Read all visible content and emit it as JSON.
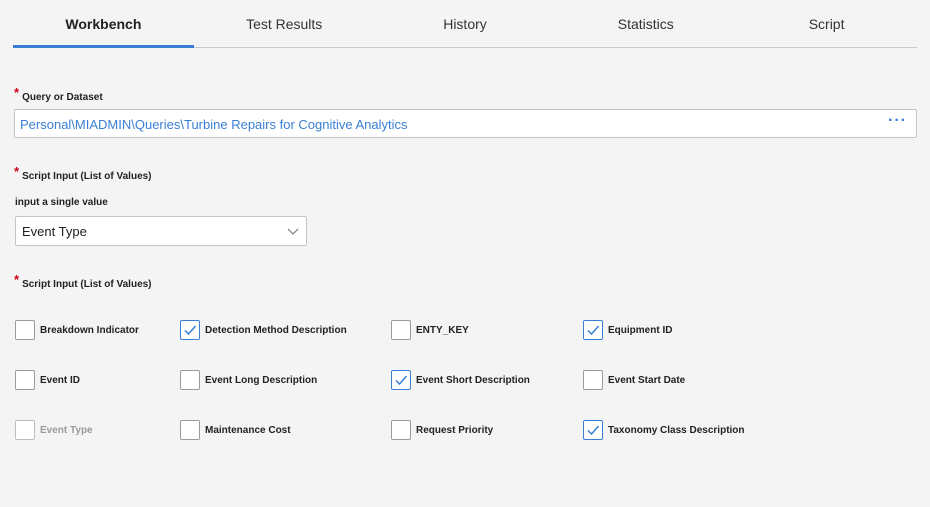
{
  "tabs": [
    {
      "label": "Workbench",
      "active": true
    },
    {
      "label": "Test Results",
      "active": false
    },
    {
      "label": "History",
      "active": false
    },
    {
      "label": "Statistics",
      "active": false
    },
    {
      "label": "Script",
      "active": false
    }
  ],
  "query": {
    "label": "Query or Dataset",
    "value": "Personal\\MIADMIN\\Queries\\Turbine Repairs for Cognitive Analytics",
    "more_icon": "ellipsis-icon"
  },
  "script_input_single": {
    "label": "Script Input (List of Values)",
    "sublabel": "input a single value",
    "selected": "Event Type"
  },
  "script_input_multi": {
    "label": "Script Input (List of Values)",
    "options": [
      {
        "label": "Breakdown Indicator",
        "checked": false,
        "disabled": false
      },
      {
        "label": "Detection Method Description",
        "checked": true,
        "disabled": false
      },
      {
        "label": "ENTY_KEY",
        "checked": false,
        "disabled": false
      },
      {
        "label": "Equipment ID",
        "checked": true,
        "disabled": false
      },
      {
        "label": "Event ID",
        "checked": false,
        "disabled": false
      },
      {
        "label": "Event Long Description",
        "checked": false,
        "disabled": false
      },
      {
        "label": "Event Short Description",
        "checked": true,
        "disabled": false
      },
      {
        "label": "Event Start Date",
        "checked": false,
        "disabled": false
      },
      {
        "label": "Event Type",
        "checked": false,
        "disabled": true
      },
      {
        "label": "Maintenance Cost",
        "checked": false,
        "disabled": false
      },
      {
        "label": "Request Priority",
        "checked": false,
        "disabled": false
      },
      {
        "label": "Taxonomy Class Description",
        "checked": true,
        "disabled": false
      }
    ]
  },
  "colors": {
    "accent": "#3a7fd5",
    "required": "#d0021b"
  }
}
